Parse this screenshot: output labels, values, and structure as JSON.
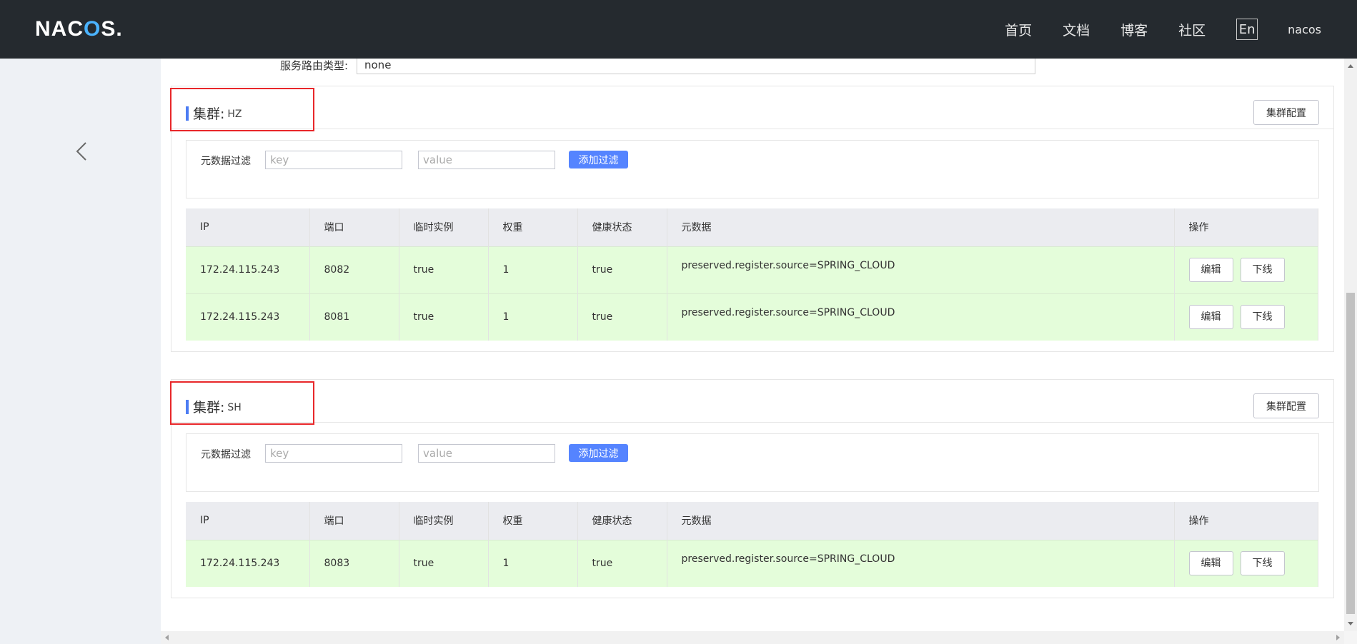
{
  "header": {
    "logo": {
      "pre": "NAC",
      "o": "O",
      "post": "S."
    },
    "nav": [
      "首页",
      "文档",
      "博客",
      "社区"
    ],
    "lang": "En",
    "user": "nacos"
  },
  "top_form": {
    "label": "服务路由类型:",
    "value": "none"
  },
  "table_headers": [
    "IP",
    "端口",
    "临时实例",
    "权重",
    "健康状态",
    "元数据",
    "操作"
  ],
  "filter": {
    "label": "元数据过滤",
    "key_placeholder": "key",
    "value_placeholder": "value",
    "add_label": "添加过滤"
  },
  "actions": {
    "edit": "编辑",
    "offline": "下线",
    "cluster_config": "集群配置"
  },
  "clusters": [
    {
      "title": "集群:",
      "name": "HZ",
      "rows": [
        {
          "ip": "172.24.115.243",
          "port": "8082",
          "ephemeral": "true",
          "weight": "1",
          "healthy": "true",
          "metadata": "preserved.register.source=SPRING_CLOUD"
        },
        {
          "ip": "172.24.115.243",
          "port": "8081",
          "ephemeral": "true",
          "weight": "1",
          "healthy": "true",
          "metadata": "preserved.register.source=SPRING_CLOUD"
        }
      ]
    },
    {
      "title": "集群:",
      "name": "SH",
      "rows": [
        {
          "ip": "172.24.115.243",
          "port": "8083",
          "ephemeral": "true",
          "weight": "1",
          "healthy": "true",
          "metadata": "preserved.register.source=SPRING_CLOUD"
        }
      ]
    }
  ],
  "colors": {
    "accent": "#5584ff",
    "row_bg": "#e4fdda",
    "highlight": "#e8272a",
    "topbar": "#252a2f"
  }
}
